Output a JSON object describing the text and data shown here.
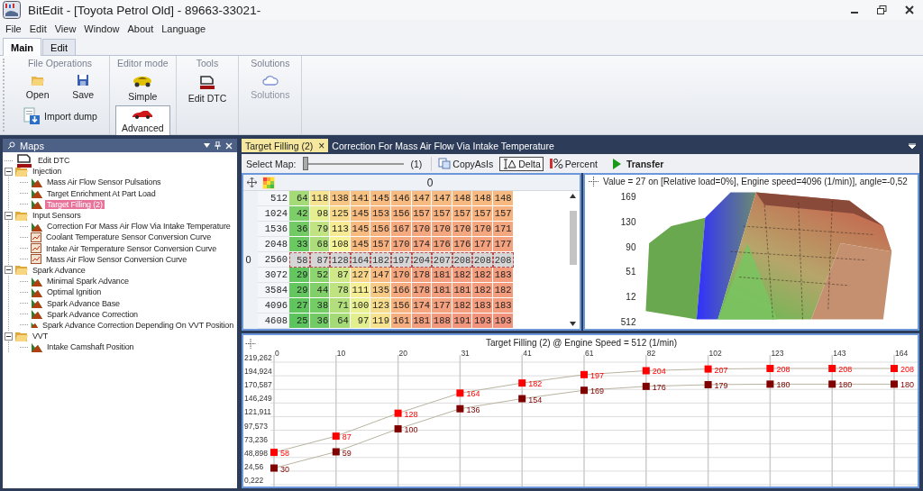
{
  "window": {
    "title": "BitEdit - [Toyota Petrol Old] - 89663-33021-"
  },
  "menu": [
    "File",
    "Edit",
    "View",
    "Window",
    "About",
    "Language"
  ],
  "ribbon_tabs": [
    {
      "label": "Main",
      "selected": true
    },
    {
      "label": "Edit",
      "selected": false
    }
  ],
  "ribbon_groups": [
    {
      "title": "File Operations",
      "buttons": [
        {
          "label": "Open",
          "kind": "open",
          "disabled": false
        },
        {
          "label": "Save",
          "kind": "save",
          "disabled": false
        },
        {
          "label": "Import dump",
          "kind": "import",
          "disabled": false
        }
      ]
    },
    {
      "title": "Editor mode",
      "buttons": [
        {
          "label": "Simple",
          "kind": "simple",
          "disabled": false,
          "selected": false
        },
        {
          "label": "Advanced",
          "kind": "advanced",
          "disabled": false,
          "selected": true
        }
      ]
    },
    {
      "title": "Tools",
      "buttons": [
        {
          "label": "Edit DTC",
          "kind": "dtc",
          "disabled": false
        }
      ]
    },
    {
      "title": "Solutions",
      "buttons": [
        {
          "label": "Solutions",
          "kind": "cloud",
          "disabled": true
        }
      ]
    }
  ],
  "maps_panel": {
    "title": "Maps",
    "tree": [
      {
        "label": "Edit DTC",
        "kind": "dtc",
        "selected": false
      },
      {
        "label": "Injection",
        "kind": "folder",
        "expanded": true,
        "selected": false,
        "children": [
          {
            "label": "Mass Air Flow Sensor Pulsations",
            "kind": "map",
            "selected": false
          },
          {
            "label": "Target Enrichment At Part Load",
            "kind": "map",
            "selected": false
          },
          {
            "label": "Target Filling (2)",
            "kind": "map",
            "selected": true
          }
        ]
      },
      {
        "label": "Input Sensors",
        "kind": "folder",
        "expanded": true,
        "selected": false,
        "children": [
          {
            "label": "Correction For Mass Air Flow Via Intake Temperature",
            "kind": "map",
            "selected": false
          },
          {
            "label": "Coolant Temperature Sensor Conversion Curve",
            "kind": "curve",
            "selected": false
          },
          {
            "label": "Intake Air Temperature Sensor Conversion Curve",
            "kind": "curve",
            "selected": false
          },
          {
            "label": "Mass Air Flow Sensor Conversion Curve",
            "kind": "curve",
            "selected": false
          }
        ]
      },
      {
        "label": "Spark Advance",
        "kind": "folder",
        "expanded": true,
        "selected": false,
        "children": [
          {
            "label": "Minimal Spark Advance",
            "kind": "map",
            "selected": false
          },
          {
            "label": "Optimal Ignition",
            "kind": "map",
            "selected": false
          },
          {
            "label": "Spark Advance Base",
            "kind": "map",
            "selected": false
          },
          {
            "label": "Spark Advance Correction",
            "kind": "map",
            "selected": false
          },
          {
            "label": "Spark Advance Correction Depending On VVT Position",
            "kind": "map",
            "selected": false
          }
        ]
      },
      {
        "label": "VVT",
        "kind": "folder",
        "expanded": true,
        "selected": false,
        "children": [
          {
            "label": "Intake Camshaft Position",
            "kind": "map",
            "selected": false
          }
        ]
      }
    ]
  },
  "doc_tabs": [
    {
      "label": "Target Filling (2)",
      "selected": true,
      "close": "×"
    },
    {
      "label": "Correction For Mass Air Flow Via Intake Temperature",
      "selected": false
    }
  ],
  "toolbar": {
    "select_label": "Select Map:",
    "slider": {
      "level": 0
    },
    "slider_value": "(1)",
    "buttons": [
      {
        "label": "CopyAsIs",
        "kind": "copy",
        "selected": false
      },
      {
        "label": "Delta",
        "kind": "delta",
        "selected": true
      },
      {
        "label": "Percent",
        "kind": "percent",
        "selected": false
      },
      {
        "label": "Transfer",
        "kind": "transfer",
        "selected": false
      }
    ]
  },
  "table": {
    "column_axis": "0",
    "row_axis": "0",
    "rows": [
      {
        "header": "512",
        "selected": false,
        "values": [
          "64",
          "118",
          "138",
          "141",
          "145",
          "146",
          "147",
          "147",
          "148",
          "148",
          "148"
        ]
      },
      {
        "header": "1024",
        "selected": false,
        "values": [
          "42",
          "98",
          "125",
          "145",
          "153",
          "156",
          "157",
          "157",
          "157",
          "157",
          "157"
        ]
      },
      {
        "header": "1536",
        "selected": false,
        "values": [
          "36",
          "79",
          "113",
          "145",
          "156",
          "167",
          "170",
          "170",
          "170",
          "170",
          "171"
        ]
      },
      {
        "header": "2048",
        "selected": false,
        "values": [
          "33",
          "68",
          "108",
          "145",
          "157",
          "170",
          "174",
          "176",
          "176",
          "177",
          "177"
        ]
      },
      {
        "header": "2560",
        "selected": true,
        "values": [
          "58",
          "87",
          "128",
          "164",
          "182",
          "197",
          "204",
          "207",
          "208",
          "208",
          "208"
        ]
      },
      {
        "header": "3072",
        "selected": false,
        "values": [
          "29",
          "52",
          "87",
          "127",
          "147",
          "170",
          "178",
          "181",
          "182",
          "182",
          "183"
        ]
      },
      {
        "header": "3584",
        "selected": false,
        "values": [
          "29",
          "44",
          "78",
          "111",
          "135",
          "166",
          "178",
          "181",
          "181",
          "182",
          "182"
        ]
      },
      {
        "header": "4096",
        "selected": false,
        "values": [
          "27",
          "38",
          "71",
          "100",
          "123",
          "156",
          "174",
          "177",
          "182",
          "183",
          "183"
        ]
      },
      {
        "header": "4608",
        "selected": false,
        "values": [
          "25",
          "36",
          "64",
          "97",
          "119",
          "161",
          "181",
          "188",
          "191",
          "193",
          "193"
        ]
      }
    ]
  },
  "surface": {
    "info": "Value = 27 on [Relative load=0%], Engine speed=4096 (1/min)], angle=-0,52",
    "z_labels": [
      "169",
      "130",
      "90",
      "51",
      "12"
    ],
    "y_label": "512"
  },
  "line_chart": {
    "chart_data": {
      "type": "line",
      "title": "Target Filling (2) @ Engine Speed = 512 (1/min)",
      "categories": [
        "0",
        "10",
        "20",
        "31",
        "41",
        "61",
        "82",
        "102",
        "123",
        "143",
        "164"
      ],
      "series": [
        {
          "color": "#ff0000",
          "marker": "square",
          "values": [
            58,
            87,
            128,
            164,
            182,
            197,
            204,
            207,
            208,
            208,
            208
          ]
        },
        {
          "color": "#800000",
          "marker": "square",
          "values": [
            30,
            59,
            100,
            136,
            154,
            169,
            176,
            179,
            180,
            180,
            180
          ]
        }
      ],
      "ylim": [
        0.222,
        219.262
      ],
      "yticks": [
        {
          "value": 219.262,
          "label": "219,262"
        },
        {
          "value": 194.924,
          "label": "194,924"
        },
        {
          "value": 170.587,
          "label": "170,587"
        },
        {
          "value": 146.249,
          "label": "146,249"
        },
        {
          "value": 121.911,
          "label": "121,911"
        },
        {
          "value": 97.573,
          "label": "97,573"
        },
        {
          "value": 73.236,
          "label": "73,236"
        },
        {
          "value": 48.898,
          "label": "48,898"
        },
        {
          "value": 24.56,
          "label": "24,56"
        },
        {
          "value": 0.222,
          "label": "0,222"
        }
      ],
      "grid": true,
      "data_labels": true
    }
  }
}
